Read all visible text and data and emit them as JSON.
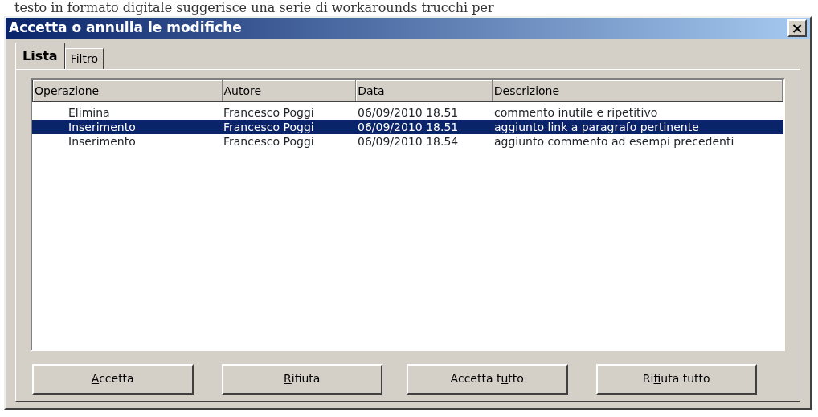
{
  "background_text": "testo in formato digitale suggerisce una serie di workarounds trucchi per",
  "window": {
    "title": "Accetta o annulla le modifiche",
    "close": "×"
  },
  "tabs": [
    {
      "label": "Lista",
      "selected": true
    },
    {
      "label": "Filtro",
      "selected": false
    }
  ],
  "table": {
    "columns": [
      "Operazione",
      "Autore",
      "Data",
      "Descrizione"
    ],
    "rows": [
      {
        "cells": [
          "Elimina",
          "Francesco Poggi",
          "06/09/2010 18.51",
          "commento inutile e ripetitivo"
        ],
        "selected": false
      },
      {
        "cells": [
          "Inserimento",
          "Francesco Poggi",
          "06/09/2010 18.51",
          "aggiunto link a paragrafo pertinente"
        ],
        "selected": true
      },
      {
        "cells": [
          "Inserimento",
          "Francesco Poggi",
          "06/09/2010 18.54",
          "aggiunto commento ad esempi precedenti"
        ],
        "selected": false
      }
    ]
  },
  "buttons": [
    {
      "access_key": "A",
      "label_after": "ccetta"
    },
    {
      "access_key": "R",
      "label_after": "ifiuta"
    },
    {
      "label_before": "Accetta t",
      "access_key": "u",
      "label_after": "tto"
    },
    {
      "label_before": "Ri",
      "access_key": "f",
      "label_after": "iuta tutto"
    }
  ]
}
